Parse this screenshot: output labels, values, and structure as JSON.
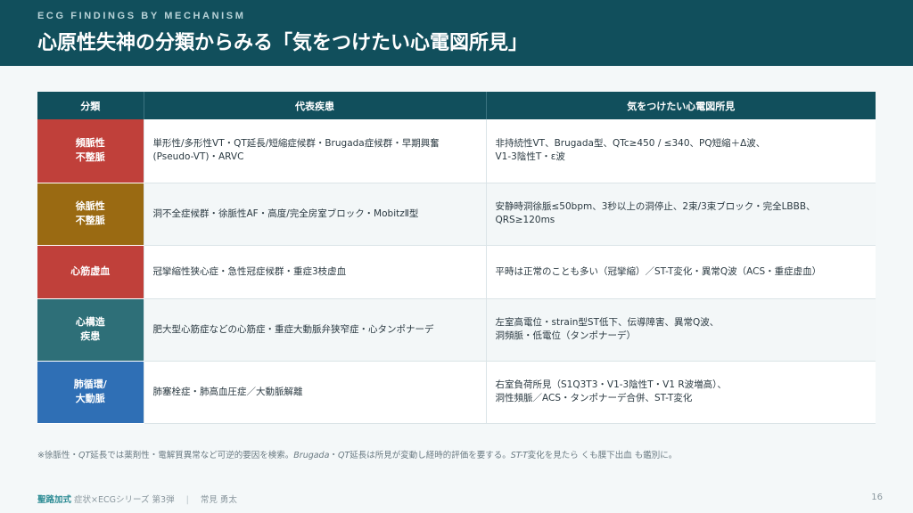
{
  "header": {
    "eyebrow": "ECG FINDINGS BY MECHANISM",
    "title": "心原性失神の分類からみる「気をつけたい心電図所見」"
  },
  "table": {
    "columns": [
      "分類",
      "代表疾患",
      "気をつけたい心電図所見"
    ],
    "rows": [
      {
        "category": [
          "頻脈性",
          "不整脈"
        ],
        "color": "#c0403a",
        "diseases": [
          "単形性/多形性VT・QT延長/短縮症候群・Brugada症候群・早期興奮",
          "(Pseudo-VT)・ARVC"
        ],
        "findings": [
          "非持続性VT、Brugada型、QTc≥450 / ≤340、PQ短縮＋Δ波、",
          "V1-3陰性T・ε波"
        ]
      },
      {
        "category": [
          "徐脈性",
          "不整脈"
        ],
        "color": "#9a6a12",
        "diseases": [
          "洞不全症候群・徐脈性AF・高度/完全房室ブロック・MobitzⅡ型"
        ],
        "findings": [
          "安静時洞徐脈≤50bpm、3秒以上の洞停止、2束/3束ブロック・完全LBBB、",
          "QRS≥120ms"
        ]
      },
      {
        "category": [
          "心筋虚血"
        ],
        "color": "#c0403a",
        "diseases": [
          "冠攣縮性狭心症・急性冠症候群・重症3枝虚血"
        ],
        "findings": [
          "平時は正常のことも多い（冠攣縮）／ST-T変化・異常Q波（ACS・重症虚血）"
        ]
      },
      {
        "category": [
          "心構造",
          "疾患"
        ],
        "color": "#2e6f78",
        "diseases": [
          "肥大型心筋症などの心筋症・重症大動脈弁狭窄症・心タンポナーデ"
        ],
        "findings": [
          "左室高電位・strain型ST低下、伝導障害、異常Q波、",
          "洞頻脈・低電位（タンポナーデ）"
        ]
      },
      {
        "category": [
          "肺循環/",
          "大動脈"
        ],
        "color": "#2f6fb5",
        "diseases": [
          "肺塞栓症・肺高血圧症／大動脈解離"
        ],
        "findings": [
          "右室負荷所見（S1Q3T3・V1-3陰性T・V1 R波増高）、",
          "洞性頻脈／ACS・タンポナーデ合併、ST-T変化"
        ]
      }
    ]
  },
  "footnote": {
    "p1": "※徐脈性・",
    "qt1": "QT",
    "p2": "延長では薬剤性・電解質異常など可逆的要因を検索。",
    "brugada": "Brugada",
    "p3": "・",
    "qt2": "QT",
    "p4": "延長は所見が変動し経時的評価を要する。",
    "stt": "ST-T",
    "p5": "変化を見たら くも膜下出血 も鑑別に。"
  },
  "footer": {
    "brand": "聖路加式",
    "series": "症状×ECGシリーズ 第3弾",
    "divider": "|",
    "author": "常見 勇太",
    "page": "16"
  }
}
